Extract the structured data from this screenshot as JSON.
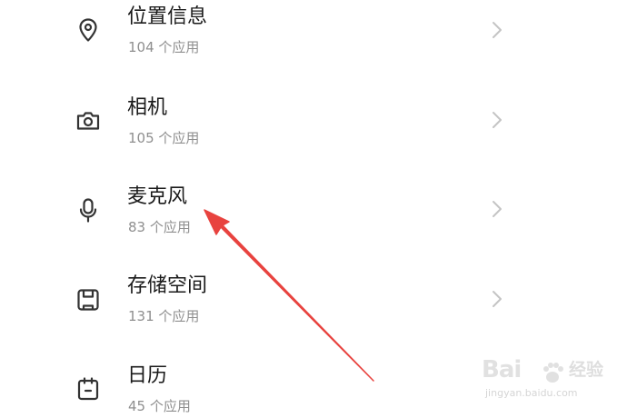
{
  "permissions": [
    {
      "icon": "location-pin-icon",
      "title": "位置信息",
      "subtitle": "104 个应用"
    },
    {
      "icon": "camera-icon",
      "title": "相机",
      "subtitle": "105 个应用"
    },
    {
      "icon": "microphone-icon",
      "title": "麦克风",
      "subtitle": "83 个应用"
    },
    {
      "icon": "storage-icon",
      "title": "存储空间",
      "subtitle": "131 个应用"
    },
    {
      "icon": "calendar-icon",
      "title": "日历",
      "subtitle": "45 个应用"
    }
  ],
  "annotation": {
    "color": "#e8433f",
    "points_to": "麦克风"
  },
  "watermark": {
    "brand": "Bai",
    "site": "经验",
    "url": "jingyan.baidu.com"
  },
  "colors": {
    "title": "#1a1a1a",
    "subtitle": "#8f8f8f",
    "chevron": "#c4c4c4",
    "icon": "#333333"
  }
}
